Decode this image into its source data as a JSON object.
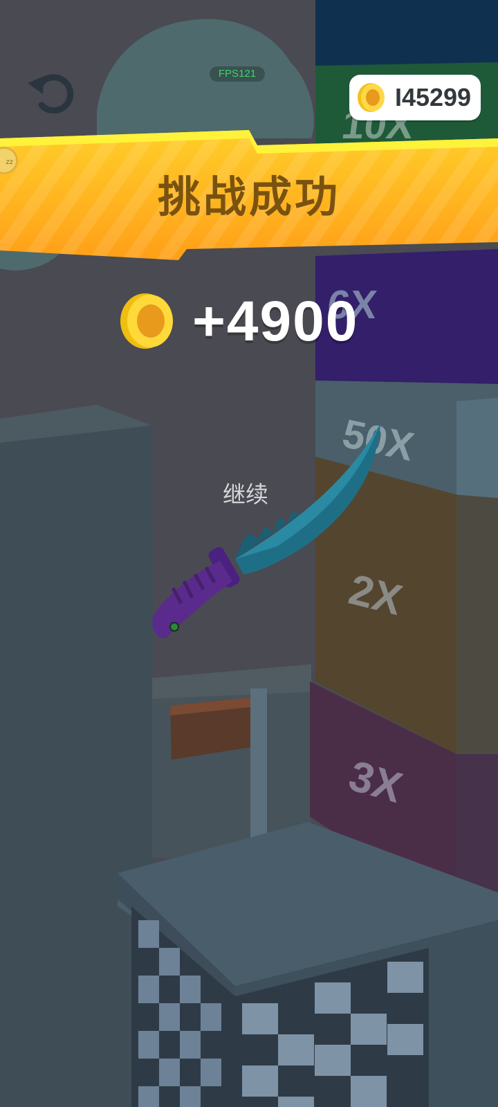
{
  "hud": {
    "fps_label": "FPS121",
    "coin_balance": "I45299",
    "undo_icon": "undo-arrow-icon",
    "coin_icon": "gold-coin-icon"
  },
  "banner": {
    "title": "挑战成功",
    "side_badge": "zz"
  },
  "reward": {
    "amount": "+4900"
  },
  "actions": {
    "continue_label": "继续"
  },
  "tower": {
    "blocks": [
      {
        "label": "10X",
        "color": "#1f5a3a"
      },
      {
        "label": "6X",
        "color": "#35206a"
      },
      {
        "label": "50X",
        "color": "#4a5f6a"
      },
      {
        "label": "2X",
        "color": "#57472e"
      },
      {
        "label": "3X",
        "color": "#4a2f4a"
      }
    ]
  },
  "colors": {
    "banner_yellow": "#ffc21f",
    "banner_orange": "#ffa51c",
    "coin_gold": "#f5c518",
    "knife_blade": "#1e6f86",
    "knife_handle": "#5a2a8c",
    "fps_green": "#3fd36a"
  },
  "knife": {
    "icon": "knife-icon"
  }
}
